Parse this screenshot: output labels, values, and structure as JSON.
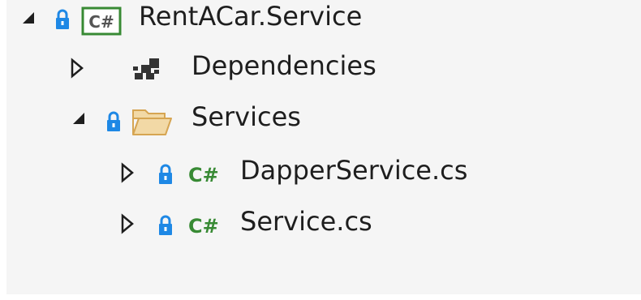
{
  "colors": {
    "panel_bg": "#f5f5f5",
    "lock_blue": "#1e88e5",
    "csharp_green": "#388a34",
    "folder_fill": "#f2d9a6",
    "folder_stroke": "#d6a552",
    "arrow_dark": "#1e1e1e"
  },
  "tree": {
    "project": {
      "label": "RentACar.Service",
      "state": "expanded",
      "icon": "csharp-project-icon",
      "badge_text": "C#"
    },
    "dependencies": {
      "label": "Dependencies",
      "state": "collapsed",
      "icon": "dependencies-icon"
    },
    "services_folder": {
      "label": "Services",
      "state": "expanded",
      "icon": "folder-open-icon"
    },
    "files": [
      {
        "label": "DapperService.cs",
        "state": "collapsed",
        "icon": "csharp-file-icon",
        "icon_text": "C#"
      },
      {
        "label": "Service.cs",
        "state": "collapsed",
        "icon": "csharp-file-icon",
        "icon_text": "C#"
      }
    ]
  }
}
